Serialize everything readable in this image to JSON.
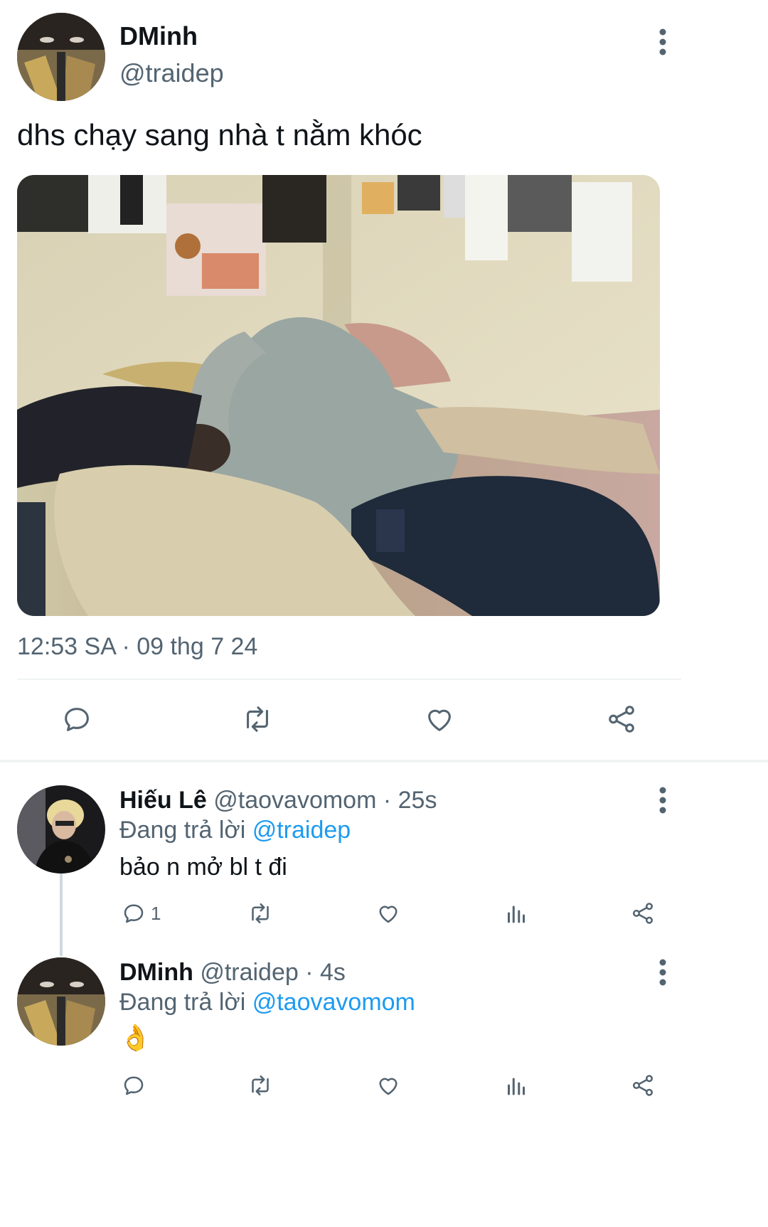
{
  "main_tweet": {
    "author_name": "DMinh",
    "author_handle": "@traidep",
    "text": "dhs chạy sang nhà t nằm khóc",
    "timestamp": "12:53 SA · 09 thg 7 24",
    "actions": [
      "reply-icon",
      "retweet-icon",
      "like-icon",
      "share-icon"
    ]
  },
  "replies": [
    {
      "author_name": "Hiếu Lê",
      "meta": "@taovavomom · 25s",
      "replying_prefix": "Đang trả lời",
      "replying_to": "@traidep",
      "text": "bảo n mở bl t đi",
      "reply_count": "1"
    },
    {
      "author_name": "DMinh",
      "meta": "@traidep · 4s",
      "replying_prefix": "Đang trả lời",
      "replying_to": "@taovavomom",
      "text": "👌",
      "reply_count": ""
    }
  ],
  "colors": {
    "text": "#0f1419",
    "secondary": "#536471",
    "link": "#1d9bf0",
    "divider": "#eff3f4"
  }
}
